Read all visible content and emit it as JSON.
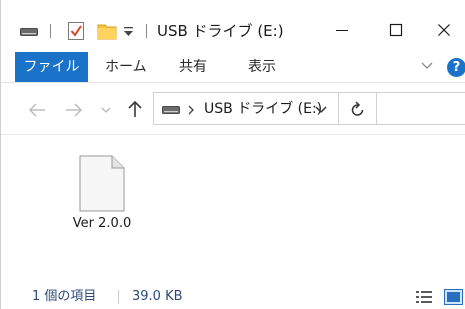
{
  "window": {
    "title": "USB ドライブ (E:)",
    "accent_color": "#1a73c9"
  },
  "quick_access": {
    "icons": [
      "drive-icon",
      "properties-check-icon",
      "new-folder-icon",
      "customize-dropdown-icon"
    ]
  },
  "title_controls": {
    "minimize": "minimize-icon",
    "maximize": "maximize-icon",
    "close": "close-icon"
  },
  "ribbon": {
    "file_tab": "ファイル",
    "tabs": [
      "ホーム",
      "共有",
      "表示"
    ],
    "help": "?"
  },
  "navigation": {
    "address_path": "USB ドライブ (E:)"
  },
  "content": {
    "items": [
      {
        "name": "Ver 2.0.0",
        "icon": "document-icon"
      }
    ]
  },
  "status": {
    "item_count": "1 個の項目",
    "size": "39.0 KB"
  }
}
